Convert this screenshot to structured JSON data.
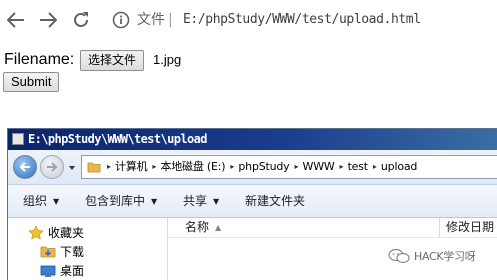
{
  "browser": {
    "info_label": "文件",
    "separator": "|",
    "url": "E:/phpStudy/WWW/test/upload.html"
  },
  "form": {
    "filename_label": "Filename:",
    "choose_button_label": "选择文件",
    "selected_file": "1.jpg",
    "submit_label": "Submit"
  },
  "dialog": {
    "title": "E:\\phpStudy\\WWW\\test\\upload",
    "breadcrumbs": [
      {
        "label": "计算机"
      },
      {
        "label": "本地磁盘 (E:)"
      },
      {
        "label": "phpStudy"
      },
      {
        "label": "WWW"
      },
      {
        "label": "test"
      },
      {
        "label": "upload"
      }
    ],
    "toolbar": {
      "organize": "组织",
      "include_in_library": "包含到库中",
      "share": "共享",
      "new_folder": "新建文件夹"
    },
    "nav": {
      "favorites": "收藏夹",
      "downloads": "下载",
      "desktop": "桌面"
    },
    "columns": {
      "name": "名称",
      "date_modified": "修改日期"
    }
  },
  "watermark": {
    "text": "HACK学习呀"
  },
  "colors": {
    "title_bar": "#0a246a",
    "dialog_bg": "#dce6f4",
    "folder": "#e8b84a"
  }
}
